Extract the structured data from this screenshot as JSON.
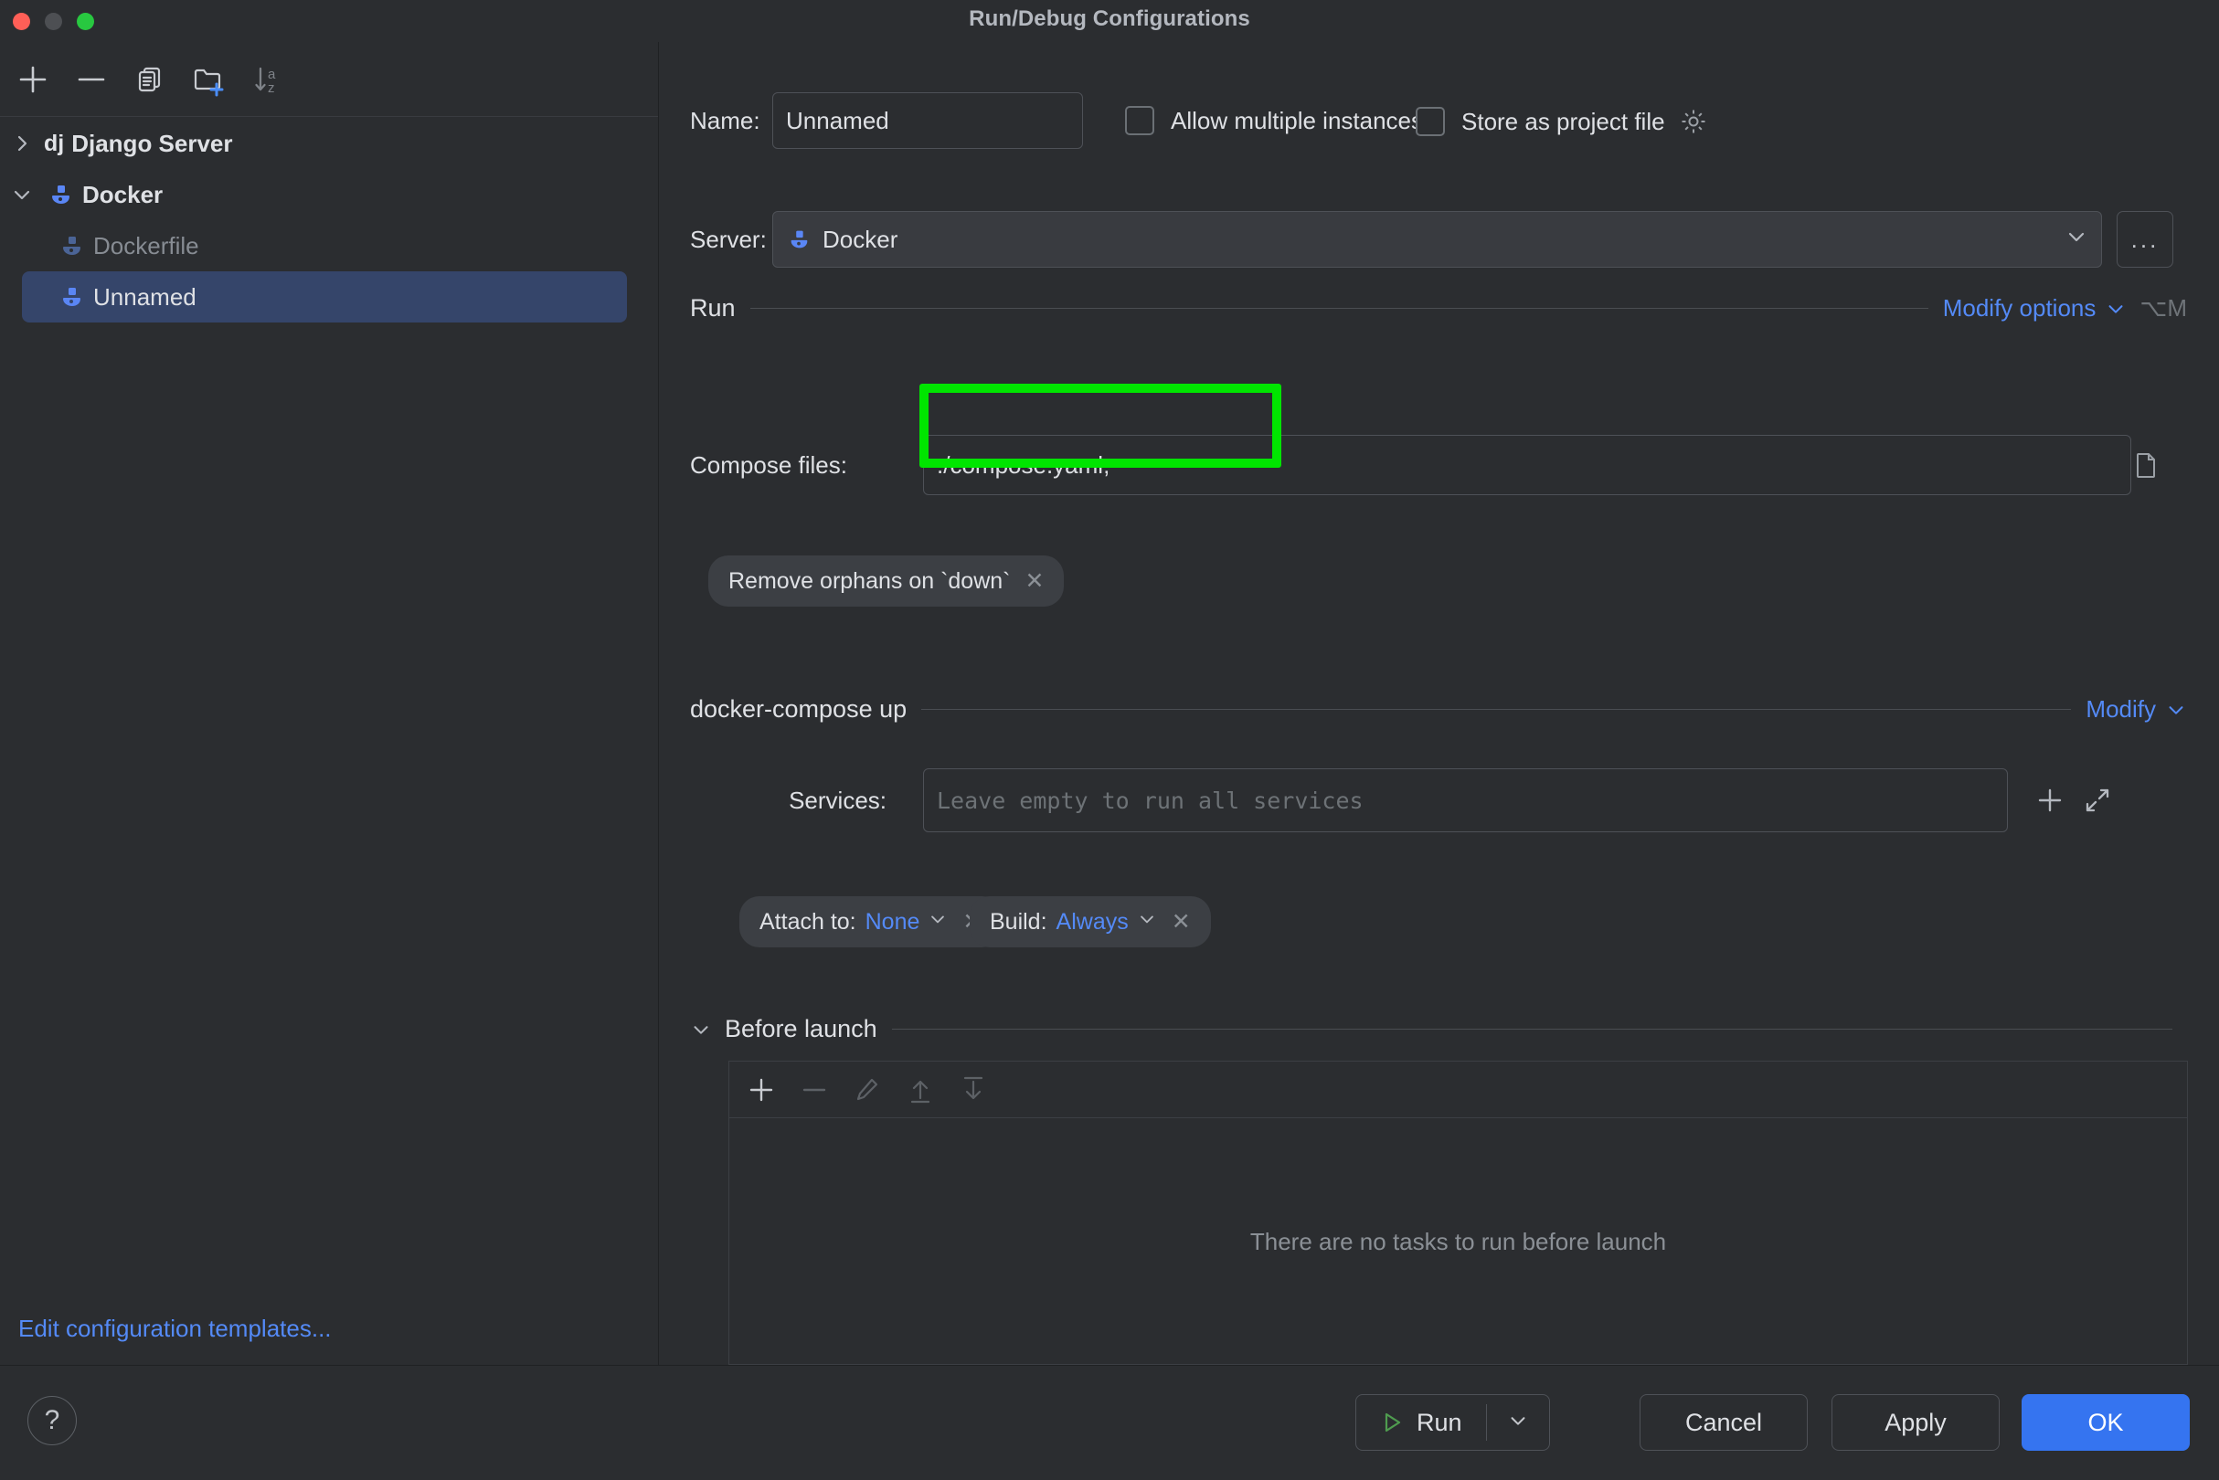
{
  "window": {
    "title": "Run/Debug Configurations",
    "traffic_lights": [
      "close-red",
      "minimize-yellow",
      "zoom-green"
    ]
  },
  "sidebar": {
    "toolbar": [
      {
        "name": "add-configuration",
        "icon": "plus-icon"
      },
      {
        "name": "remove-configuration",
        "icon": "minus-icon"
      },
      {
        "name": "copy-configuration",
        "icon": "copy-icon"
      },
      {
        "name": "new-folder",
        "icon": "folder-plus-icon"
      },
      {
        "name": "sort-alphabetically",
        "icon": "sort-az-icon"
      }
    ],
    "tree": [
      {
        "label": "Django Server",
        "badge": "dj",
        "level": 0,
        "expanded": false,
        "icon": "django-icon",
        "selected": false,
        "dim": false
      },
      {
        "label": "Docker",
        "badge": "",
        "level": 0,
        "expanded": true,
        "icon": "docker-icon",
        "selected": false,
        "dim": false
      },
      {
        "label": "Dockerfile",
        "badge": "",
        "level": 1,
        "expanded": null,
        "icon": "docker-icon",
        "selected": false,
        "dim": true
      },
      {
        "label": "Unnamed",
        "badge": "",
        "level": 1,
        "expanded": null,
        "icon": "docker-icon",
        "selected": true,
        "dim": false
      }
    ],
    "edit_templates_link": "Edit configuration templates..."
  },
  "form": {
    "name_label": "Name:",
    "name_value": "Unnamed",
    "allow_multiple_instances_label": "Allow multiple instances",
    "allow_multiple_instances_checked": false,
    "store_as_project_file_label": "Store as project file",
    "store_as_project_file_checked": false,
    "store_gear_icon": "gear-icon",
    "server_label": "Server:",
    "server_value": "Docker",
    "server_more_button": "...",
    "run_section_title": "Run",
    "modify_options_label": "Modify options",
    "modify_options_shortcut": "⌥M",
    "compose_files_label": "Compose files:",
    "compose_files_value": "./compose.yaml;",
    "compose_browse_icon": "file-browse-icon",
    "remove_orphans_chip": "Remove orphans on `down`",
    "compose_up_section_title": "docker-compose up",
    "modify_label": "Modify",
    "services_label": "Services:",
    "services_placeholder": "Leave empty to run all services",
    "services_value": "",
    "services_add_icon": "plus-icon",
    "services_expand_icon": "expand-icon",
    "attach_to_label": "Attach to:",
    "attach_to_value": "None",
    "build_label": "Build:",
    "build_value": "Always"
  },
  "before_launch": {
    "title": "Before launch",
    "expanded": true,
    "toolbar": [
      {
        "name": "add-task",
        "icon": "plus-icon",
        "enabled": true
      },
      {
        "name": "remove-task",
        "icon": "minus-icon",
        "enabled": false
      },
      {
        "name": "edit-task",
        "icon": "pencil-icon",
        "enabled": false
      },
      {
        "name": "move-task-up",
        "icon": "arrow-up-icon",
        "enabled": false
      },
      {
        "name": "move-task-down",
        "icon": "arrow-down-icon",
        "enabled": false
      }
    ],
    "empty_text": "There are no tasks to run before launch"
  },
  "footer": {
    "help_glyph": "?",
    "run_label": "Run",
    "run_icon": "play-icon",
    "run_dropdown_icon": "chevron-down-icon",
    "cancel_label": "Cancel",
    "apply_label": "Apply",
    "ok_label": "OK"
  },
  "highlight": {
    "color": "#00e500",
    "target": "compose-files-input"
  },
  "colors": {
    "background": "#2b2d30",
    "selection": "#35456a",
    "accent_blue": "#548af7",
    "primary_button": "#3574f0",
    "docker_blue": "#5a86f5",
    "highlight_green": "#00e500"
  }
}
